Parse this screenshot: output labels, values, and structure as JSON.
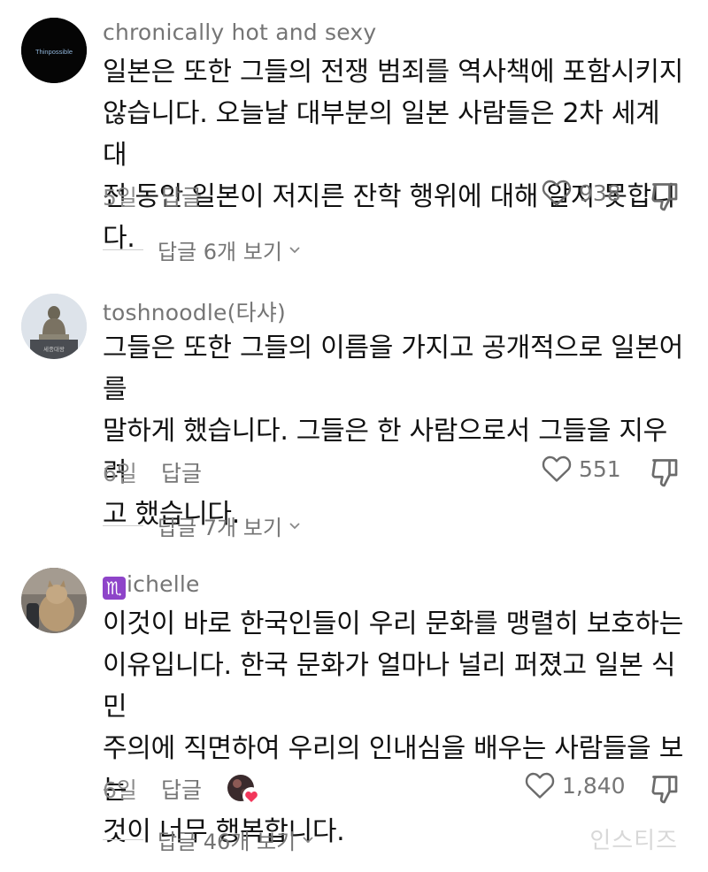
{
  "comments": [
    {
      "username": "chronically hot and sexy",
      "avatar_text": "Thinpossible",
      "lines": [
        "일본은 또한 그들의 전쟁 범죄를 역사책에 포함시키지",
        "않습니다. 오늘날 대부분의 일본 사람들은 2차 세계 대",
        "전 동안 일본이 저지른 잔학 행위에 대해 알지 못합니다."
      ],
      "time": "5일",
      "reply_label": "답글",
      "likes": "938",
      "view_replies": "답글 6개 보기"
    },
    {
      "username": "toshnoodle(타샤)",
      "avatar_text": "세종대왕",
      "lines": [
        "그들은 또한 그들의 이름을 가지고 공개적으로 일본어를",
        "말하게 했습니다. 그들은 한 사람으로서 그들을 지우려",
        "고 했습니다."
      ],
      "time": "6일",
      "reply_label": "답글",
      "likes": "551",
      "view_replies": "답글 7개 보기"
    },
    {
      "username_badge": "♏",
      "username": "ichelle",
      "lines": [
        "이것이 바로 한국인들이 우리 문화를 맹렬히 보호하는",
        "이유입니다. 한국 문화가 얼마나 널리 퍼졌고 일본 식민",
        "주의에 직면하여 우리의 인내심을 배우는 사람들을 보는",
        "것이 너무 행복합니다."
      ],
      "time": "6일",
      "reply_label": "답글",
      "likes": "1,840",
      "view_replies": "답글 46개 보기"
    }
  ],
  "icons": {
    "like": "heart-outline-icon",
    "dislike": "thumbs-down-icon",
    "chevron": "chevron-down-icon",
    "creator_liked": "creator-heart-badge-icon"
  },
  "colors": {
    "text": "#111111",
    "muted": "#757575",
    "liked_heart": "#f2365a"
  },
  "watermark": "인스티즈"
}
